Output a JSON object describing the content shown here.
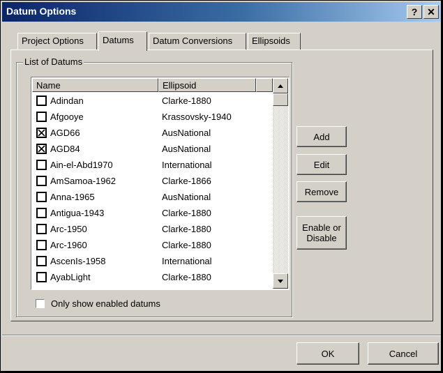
{
  "window": {
    "title": "Datum Options",
    "help_label": "?",
    "close_label": "✕"
  },
  "tabs": [
    {
      "label": "Project Options"
    },
    {
      "label": "Datums"
    },
    {
      "label": "Datum Conversions"
    },
    {
      "label": "Ellipsoids"
    }
  ],
  "group": {
    "label": "List of Datums"
  },
  "list": {
    "columns": [
      {
        "label": "Name"
      },
      {
        "label": "Ellipsoid"
      }
    ],
    "rows": [
      {
        "name": "Adindan",
        "ellipsoid": "Clarke-1880",
        "checked": false
      },
      {
        "name": "Afgooye",
        "ellipsoid": "Krassovsky-1940",
        "checked": false
      },
      {
        "name": "AGD66",
        "ellipsoid": "AusNational",
        "checked": true
      },
      {
        "name": "AGD84",
        "ellipsoid": "AusNational",
        "checked": true
      },
      {
        "name": "Ain-el-Abd1970",
        "ellipsoid": "International",
        "checked": false
      },
      {
        "name": "AmSamoa-1962",
        "ellipsoid": "Clarke-1866",
        "checked": false
      },
      {
        "name": "Anna-1965",
        "ellipsoid": "AusNational",
        "checked": false
      },
      {
        "name": "Antigua-1943",
        "ellipsoid": "Clarke-1880",
        "checked": false
      },
      {
        "name": "Arc-1950",
        "ellipsoid": "Clarke-1880",
        "checked": false
      },
      {
        "name": "Arc-1960",
        "ellipsoid": "Clarke-1880",
        "checked": false
      },
      {
        "name": "AscenIs-1958",
        "ellipsoid": "International",
        "checked": false
      },
      {
        "name": "AyabLight",
        "ellipsoid": "Clarke-1880",
        "checked": false
      }
    ]
  },
  "only_enabled": {
    "label": "Only show enabled datums",
    "checked": false
  },
  "buttons": {
    "add": "Add",
    "edit": "Edit",
    "remove": "Remove",
    "enable_line1": "Enable or",
    "enable_line2": "Disable",
    "ok": "OK",
    "cancel": "Cancel"
  }
}
